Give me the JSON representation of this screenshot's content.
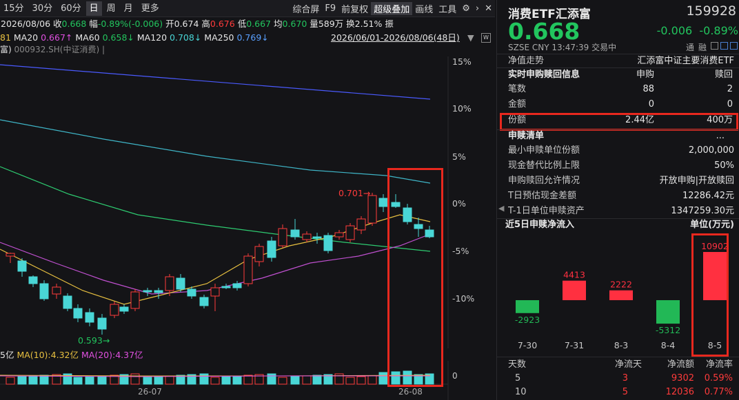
{
  "toolbar": {
    "periods": [
      "15分",
      "30分",
      "60分",
      "日",
      "周",
      "月",
      "更多"
    ],
    "active_period": "日",
    "tools": [
      "综合屏",
      "F9",
      "前复权",
      "超级叠加",
      "画线",
      "工具"
    ],
    "active_tool": "超级叠加"
  },
  "quote": {
    "date": "2026/08/06",
    "close_label": "收",
    "close": "0.668",
    "amp_label": "幅",
    "amp": "-0.89%(-0.006)",
    "open_label": "开",
    "open": "0.674",
    "high_label": "高",
    "high": "0.676",
    "low_label": "低",
    "low": "0.667",
    "avg_label": "均",
    "avg": "0.670",
    "vol_label": "量",
    "vol": "589万",
    "turn_label": "换",
    "turn": "2.51%",
    "more_label": "振"
  },
  "ma": {
    "ma0_partial": "81",
    "ma20_label": "MA20",
    "ma20": "0.667↑",
    "ma60_label": "MA60",
    "ma60": "0.658↓",
    "ma120_label": "MA120",
    "ma120": "0.708↓",
    "ma250_label": "MA250",
    "ma250": "0.769↓",
    "range": "2026/06/01-2026/08/06(48日)"
  },
  "overlay": {
    "prefix": "富)",
    "name": "000932.SH(中证消费)",
    "suffix": "|"
  },
  "main_chart": {
    "y_labels": [
      "15%",
      "10%",
      "5%",
      "0%",
      "-5%",
      "-10%"
    ],
    "high_mark": "0.701→",
    "low_mark": "0.593→",
    "x_labels": [
      "26-07",
      "26-08"
    ]
  },
  "volume": {
    "prefix": "5亿",
    "ma10_label": "MA(10):",
    "ma10": "4.32亿",
    "ma20_label": "MA(20):",
    "ma20": "4.37亿",
    "zero": "0"
  },
  "fund": {
    "name": "消费ETF汇添富",
    "code": "159928",
    "price": "0.668",
    "change": "-0.006",
    "change_pct": "-0.89%",
    "exchange": "SZSE",
    "currency": "CNY",
    "time": "13:47:39",
    "trade_status": "交易中",
    "tong": "通",
    "rong": "融"
  },
  "nav": {
    "label": "净值走势",
    "index": "汇添富中证主要消费ETF"
  },
  "realtime": {
    "title": "实时申购赎回信息",
    "col_sub": "申购",
    "col_red": "赎回",
    "rows": [
      {
        "label": "笔数",
        "sub": "88",
        "red": "2"
      },
      {
        "label": "金额",
        "sub": "0",
        "red": "0"
      },
      {
        "label": "份额",
        "sub": "2.44亿",
        "red": "400万"
      }
    ]
  },
  "list": {
    "title": "申赎清单",
    "more": "...",
    "rows": [
      {
        "label": "最小申赎单位份额",
        "value": "2,000,000"
      },
      {
        "label": "现金替代比例上限",
        "value": "50%"
      },
      {
        "label": "申购赎回允许情况",
        "value": "开放申购|开放赎回"
      },
      {
        "label": "T日预估现金差额",
        "value": "12286.42元"
      },
      {
        "label": "T-1日单位申赎资产",
        "value": "1347259.30元"
      }
    ]
  },
  "flow": {
    "title": "近5日申赎净流入",
    "unit": "单位(万元)"
  },
  "chart_data": {
    "type": "bar",
    "categories": [
      "7-30",
      "7-31",
      "8-3",
      "8-4",
      "8-5"
    ],
    "values": [
      -2923,
      4413,
      2222,
      -5312,
      10902
    ],
    "title": "近5日申赎净流入",
    "ylabel": "单位(万元)",
    "colors": {
      "positive": "#ff3040",
      "negative": "#22b856"
    }
  },
  "stats": {
    "headers": [
      "天数",
      "净流天",
      "净流额",
      "净流率"
    ],
    "rows": [
      {
        "days": "5",
        "flow_days": "3",
        "amount": "9302",
        "rate": "0.59%"
      },
      {
        "days": "10",
        "flow_days": "5",
        "amount": "12036",
        "rate": "0.77%"
      }
    ]
  },
  "colors": {
    "up": "#ff3b3b",
    "down": "#22c55e",
    "candle_down": "#49d6d6",
    "highlight": "#e8281e"
  }
}
